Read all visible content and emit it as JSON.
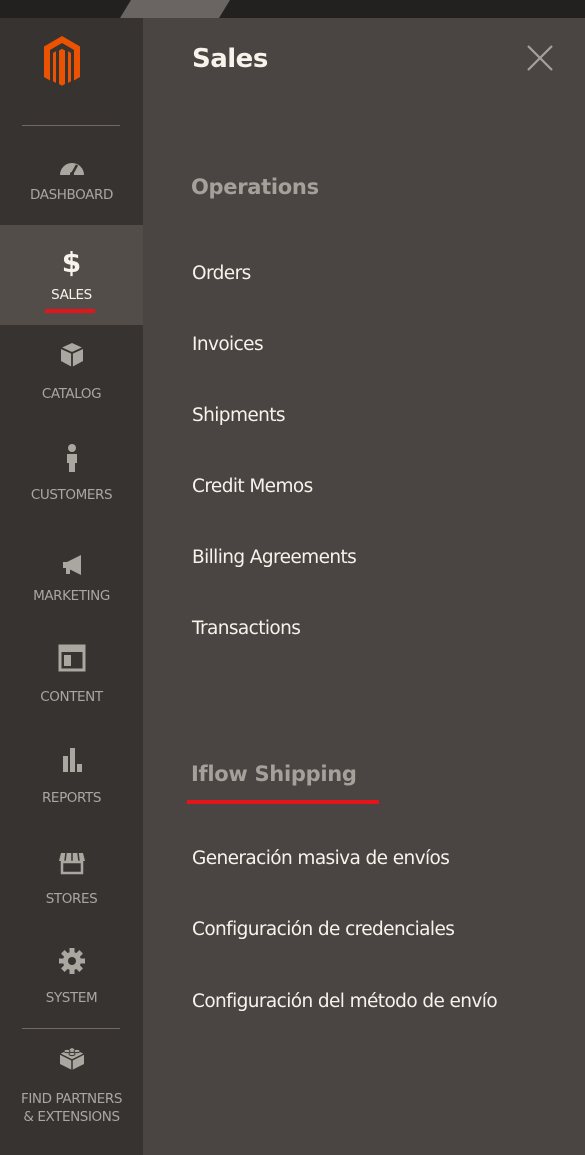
{
  "nav": {
    "items": [
      {
        "key": "dashboard",
        "label": "DASHBOARD",
        "icon": "dashboard-gauge-icon"
      },
      {
        "key": "sales",
        "label": "SALES",
        "icon": "dollar-icon",
        "active": true
      },
      {
        "key": "catalog",
        "label": "CATALOG",
        "icon": "box-icon"
      },
      {
        "key": "customers",
        "label": "CUSTOMERS",
        "icon": "person-icon"
      },
      {
        "key": "marketing",
        "label": "MARKETING",
        "icon": "megaphone-icon"
      },
      {
        "key": "content",
        "label": "CONTENT",
        "icon": "layout-icon"
      },
      {
        "key": "reports",
        "label": "REPORTS",
        "icon": "bar-chart-icon"
      },
      {
        "key": "stores",
        "label": "STORES",
        "icon": "storefront-icon"
      },
      {
        "key": "system",
        "label": "SYSTEM",
        "icon": "gear-icon"
      }
    ],
    "partners": {
      "line1": "FIND PARTNERS",
      "line2": "& EXTENSIONS",
      "icon": "lego-brick-icon"
    }
  },
  "panel": {
    "title": "Sales",
    "sections": [
      {
        "title": "Operations",
        "links": [
          "Orders",
          "Invoices",
          "Shipments",
          "Credit Memos",
          "Billing Agreements",
          "Transactions"
        ]
      },
      {
        "title": "Iflow Shipping",
        "links": [
          "Generación masiva de envíos",
          "Configuración de credenciales",
          "Configuración del método de envío"
        ]
      }
    ]
  },
  "colors": {
    "nav_bg": "#373330",
    "panel_bg": "#4a4542",
    "active_bg": "#524d49",
    "accent_red": "#e5141a",
    "logo_orange": "#eb5202",
    "text_light": "#f7f3eb",
    "text_muted": "#a6a09a"
  }
}
